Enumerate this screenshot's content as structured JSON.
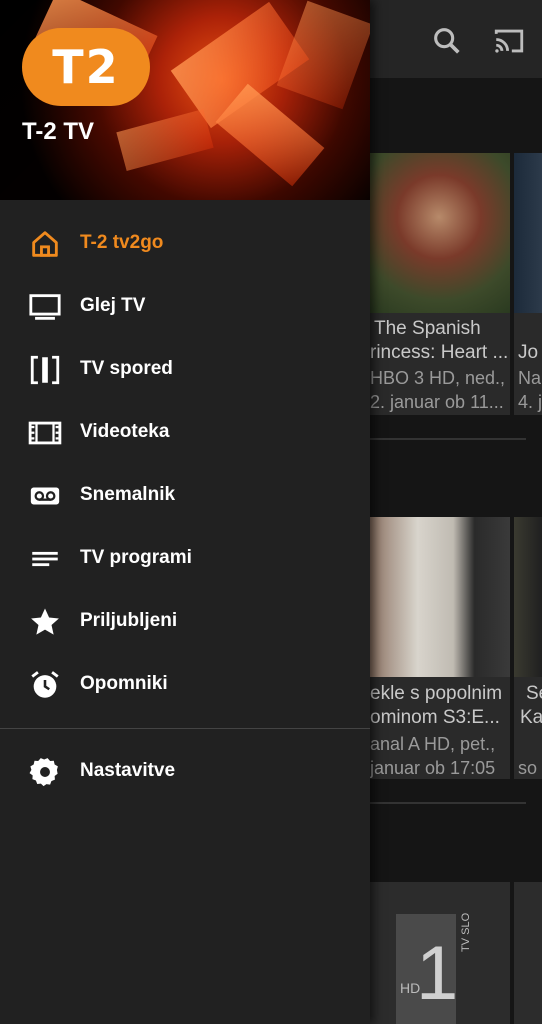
{
  "background": {
    "cards_row1": [
      {
        "title": "The Spanish",
        "title2": "rincess: Heart ...",
        "channel": "HBO 3 HD, ned.,",
        "time": "2. januar ob 11..."
      },
      {
        "title": "Jo",
        "title2": "",
        "channel": "Na",
        "time": "4. j"
      }
    ],
    "cards_row2": [
      {
        "title": "ekle s popolnim",
        "title2": "ominom S3:E...",
        "channel": "anal A HD, pet.,",
        "time": "januar ob 17:05"
      },
      {
        "title": "Se",
        "title2": "Ka",
        "channel": "",
        "time": "so"
      }
    ],
    "channel_tiles": [
      {
        "label": "HD",
        "number": "1",
        "side": "TV SLO"
      }
    ]
  },
  "drawer": {
    "logo_text": "T2",
    "app_name": "T-2 TV",
    "items": [
      {
        "label": "T-2 tv2go",
        "icon": "home-icon",
        "active": true
      },
      {
        "label": "Glej TV",
        "icon": "tv-icon",
        "active": false
      },
      {
        "label": "TV spored",
        "icon": "schedule-icon",
        "active": false
      },
      {
        "label": "Videoteka",
        "icon": "film-icon",
        "active": false
      },
      {
        "label": "Snemalnik",
        "icon": "recorder-icon",
        "active": false
      },
      {
        "label": "TV programi",
        "icon": "list-icon",
        "active": false
      },
      {
        "label": "Priljubljeni",
        "icon": "star-icon",
        "active": false
      },
      {
        "label": "Opomniki",
        "icon": "alarm-icon",
        "active": false
      }
    ],
    "settings": {
      "label": "Nastavitve",
      "icon": "gear-icon"
    }
  },
  "colors": {
    "accent": "#f08a1e",
    "drawer_bg": "#212121"
  }
}
